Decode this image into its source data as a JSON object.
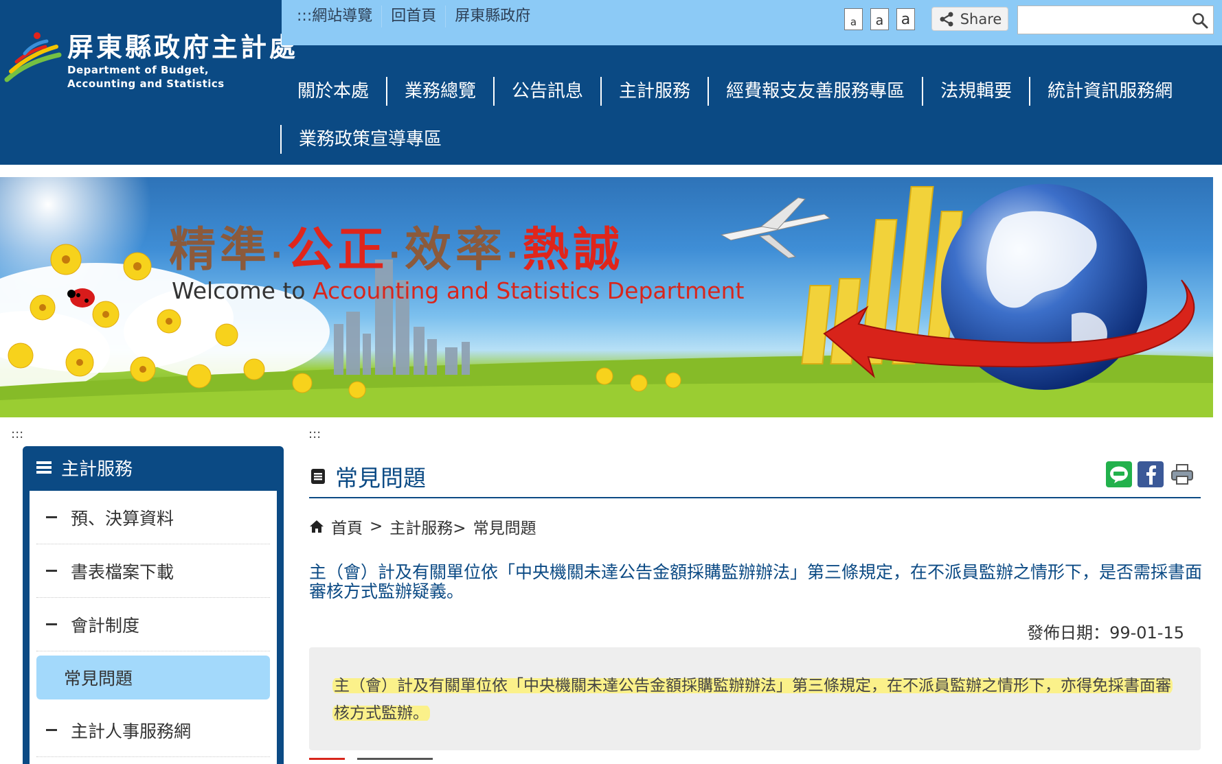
{
  "logo": {
    "title": "屏東縣政府主計處",
    "subtitle": "Department of  Budget, Accounting and Statistics"
  },
  "topbar": {
    "links": [
      ":::網站導覽",
      "回首頁",
      "屏東縣政府"
    ],
    "font_sizes": [
      "a",
      "a",
      "a"
    ],
    "share_label": "Share",
    "search_placeholder": ""
  },
  "nav": {
    "row1": [
      "關於本處",
      "業務總覽",
      "公告訊息",
      "主計服務",
      "經費報支友善服務專區",
      "法規輯要",
      "統計資訊服務網"
    ],
    "row2": [
      "業務政策宣導專區"
    ]
  },
  "banner": {
    "slogan": [
      "精準",
      "公正",
      "效率",
      "熱誠"
    ],
    "slogan_sep": "·",
    "welcome_prefix": "Welcome to ",
    "welcome_highlight": "Accounting and Statistics Department"
  },
  "sidebar": {
    "access_key": ":::",
    "title": "主計服務",
    "items": [
      {
        "label": "預、決算資料",
        "active": false
      },
      {
        "label": "書表檔案下載",
        "active": false
      },
      {
        "label": "會計制度",
        "active": false
      },
      {
        "label": "常見問題",
        "active": true
      },
      {
        "label": "主計人事服務網",
        "active": false
      }
    ]
  },
  "content": {
    "access_key": ":::",
    "page_title": "常見問題",
    "breadcrumb": [
      "首頁",
      ">",
      "主計服務>",
      "常見問題"
    ],
    "question": "主（會）計及有關單位依「中央機關未達公告金額採購監辦辦法」第三條規定，在不派員監辦之情形下，是否需採書面審核方式監辦疑義。",
    "publish_label": "發佈日期：",
    "publish_date": "99-01-15",
    "answer": "主（會）計及有關單位依「中央機關未達公告金額採購監辦辦法」第三條規定，在不派員監辦之情形下，亦得免採書面審核方式監辦。"
  },
  "colors": {
    "header_bg": "#0b4a84",
    "topbar_bg": "#8ccaf6",
    "active_item_bg": "#a3d9fb",
    "highlight": "#fbf18a",
    "accent_red": "#d8261c"
  },
  "icons": {
    "share_icons": [
      "line-icon",
      "facebook-icon",
      "print-icon"
    ]
  }
}
